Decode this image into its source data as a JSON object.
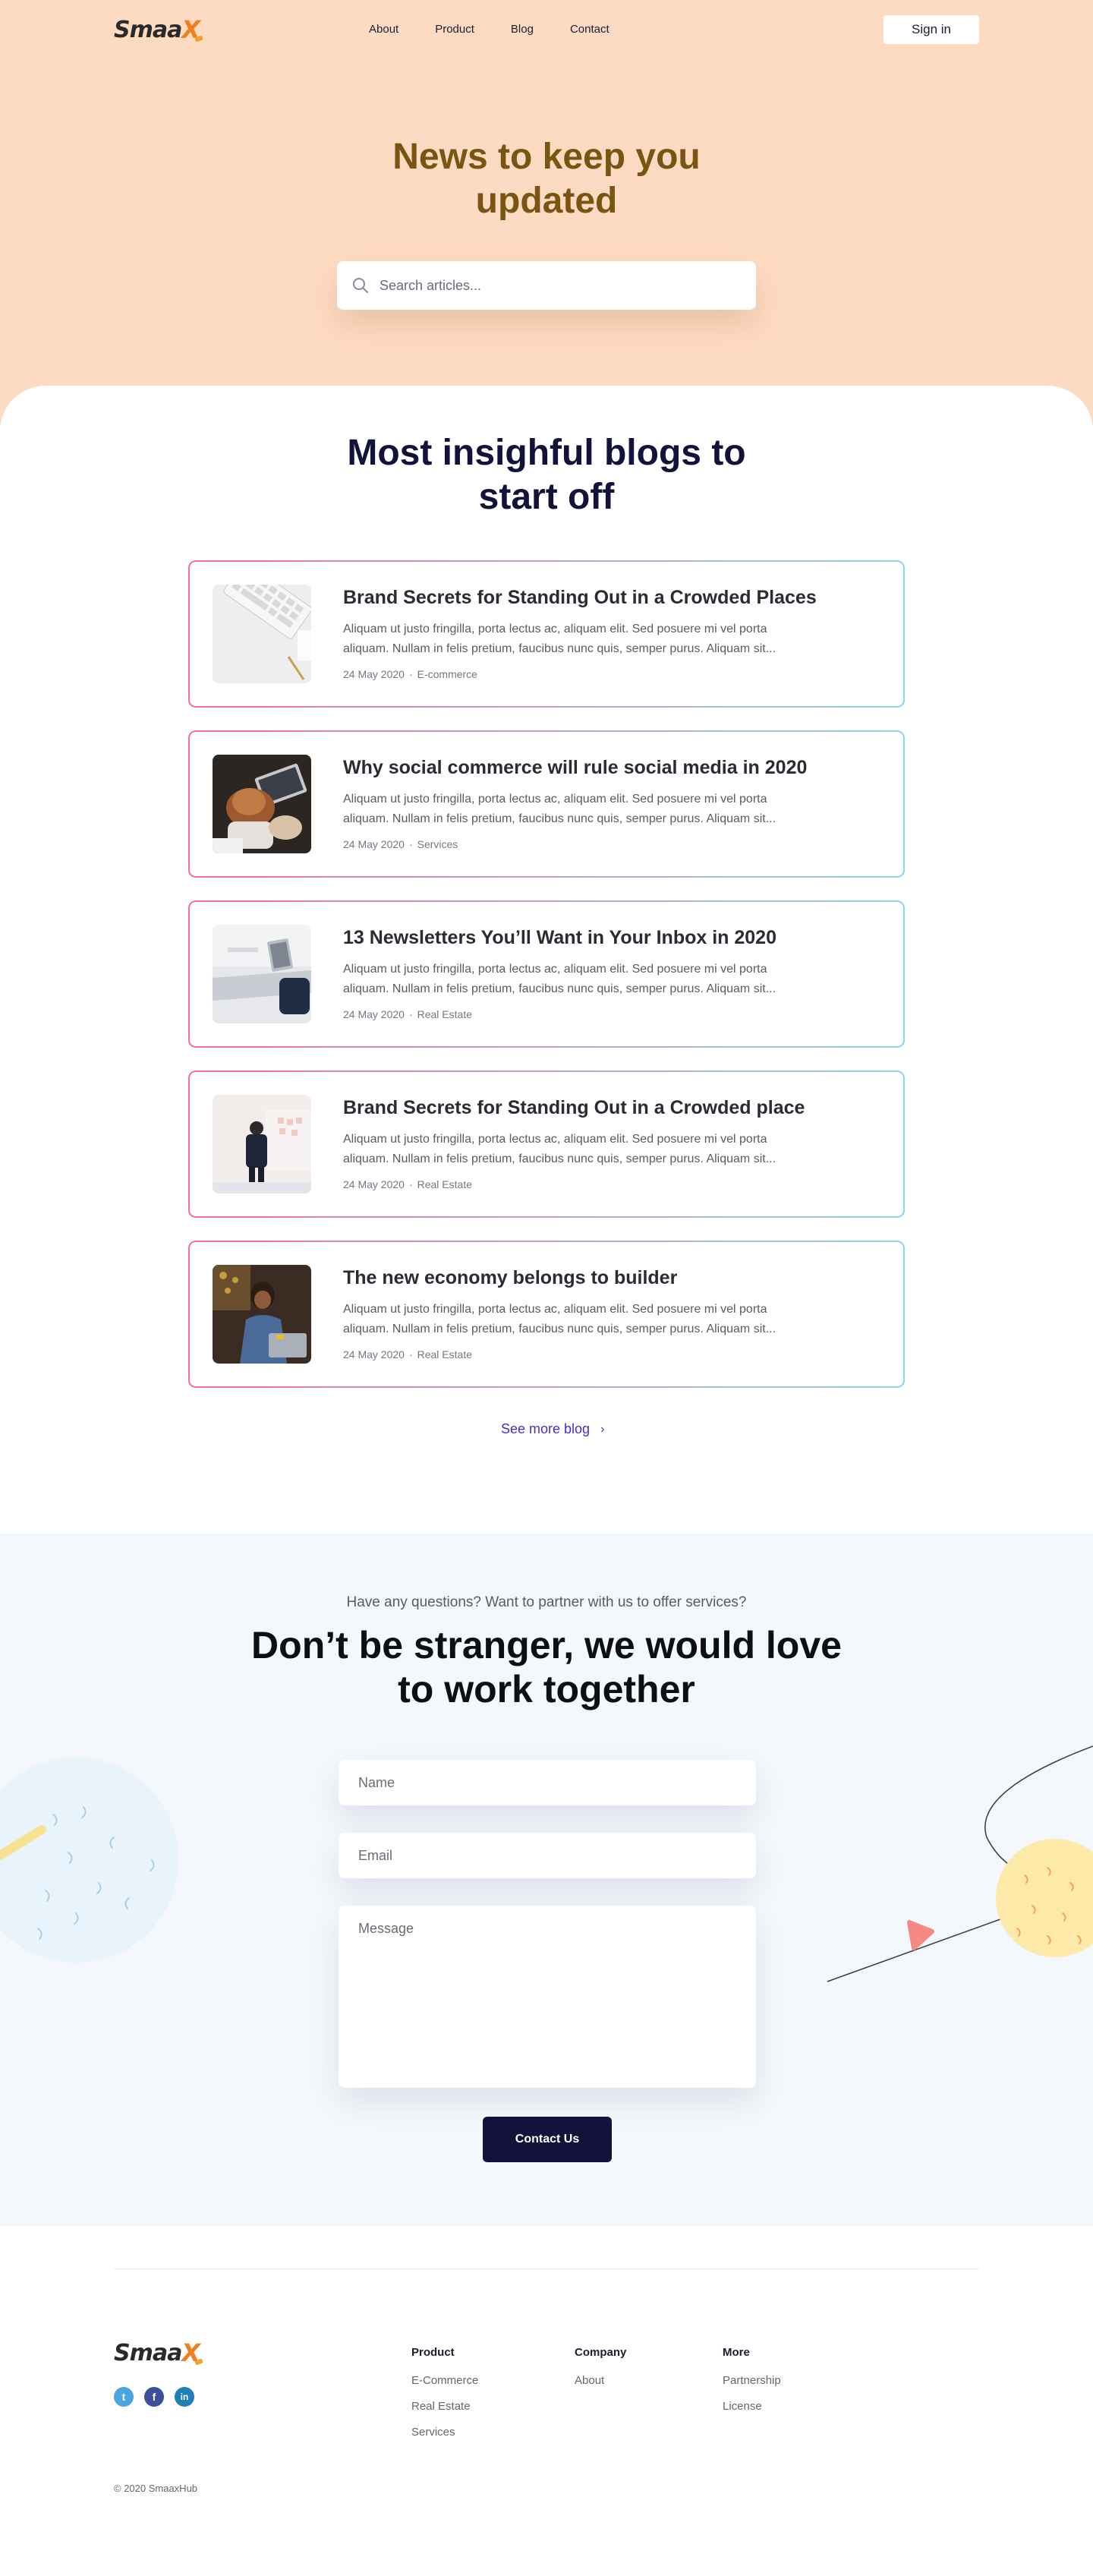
{
  "brand": {
    "logo_main": "Smaa",
    "logo_accent": "X",
    "brand_color": "#f07f1f"
  },
  "nav": {
    "links": [
      "About",
      "Product",
      "Blog",
      "Contact"
    ],
    "sign_in_label": "Sign in"
  },
  "hero": {
    "title": "News to keep you updated",
    "search_placeholder": "Search articles...",
    "background": "#fddbc2"
  },
  "blog": {
    "title": "Most insighful blogs to start off",
    "posts": [
      {
        "title": "Brand Secrets for Standing Out in a Crowded Places",
        "excerpt": "Aliquam ut justo fringilla, porta lectus ac, aliquam elit. Sed posuere mi vel porta aliquam. Nullam in felis pretium, faucibus nunc quis, semper purus.  Aliquam sit...",
        "date": "24 May 2020",
        "category": "E-commerce",
        "thumb": "keyboard-desk"
      },
      {
        "title": "Why social commerce will rule social media in 2020",
        "excerpt": "Aliquam ut justo fringilla, porta lectus ac, aliquam elit. Sed posuere mi vel porta aliquam. Nullam in felis pretium, faucibus nunc quis, semper purus.  Aliquam sit...",
        "date": "24 May 2020",
        "category": "Services",
        "thumb": "laptop-team"
      },
      {
        "title": "13 Newsletters You’ll Want in Your Inbox in 2020",
        "excerpt": "Aliquam ut justo fringilla, porta lectus ac, aliquam elit. Sed posuere mi vel porta aliquam. Nullam in felis pretium, faucibus nunc quis, semper purus.  Aliquam sit...",
        "date": "24 May 2020",
        "category": "Real Estate",
        "thumb": "office-desk"
      },
      {
        "title": "Brand Secrets for Standing Out in a Crowded place",
        "excerpt": "Aliquam ut justo fringilla, porta lectus ac, aliquam elit. Sed posuere mi vel porta aliquam. Nullam in felis pretium, faucibus nunc quis, semper purus.  Aliquam sit...",
        "date": "24 May 2020",
        "category": "Real Estate",
        "thumb": "whiteboard-person"
      },
      {
        "title": "The new economy belongs to builder",
        "excerpt": "Aliquam ut justo fringilla, porta lectus ac, aliquam elit. Sed posuere mi vel porta aliquam. Nullam in felis pretium, faucibus nunc quis, semper purus.  Aliquam sit...",
        "date": "24 May 2020",
        "category": "Real Estate",
        "thumb": "woman-laptop"
      }
    ],
    "see_more_label": "See more blog",
    "see_more_icon": "chevron-right-icon",
    "link_color": "#4a2bd0"
  },
  "contact": {
    "subtitle": "Have any questions? Want to partner with us to offer services?",
    "title": "Don’t be stranger, we would love to work together",
    "name_placeholder": "Name",
    "email_placeholder": "Email",
    "message_placeholder": "Message",
    "button_label": "Contact Us",
    "button_color": "#13123a"
  },
  "footer": {
    "socials": [
      {
        "name": "twitter-icon",
        "glyph": "t"
      },
      {
        "name": "facebook-icon",
        "glyph": "f"
      },
      {
        "name": "linkedin-icon",
        "glyph": "in"
      }
    ],
    "columns": [
      {
        "title": "Product",
        "links": [
          "E-Commerce",
          "Real Estate",
          "Services"
        ]
      },
      {
        "title": "Company",
        "links": [
          "About"
        ]
      },
      {
        "title": "More",
        "links": [
          "Partnership",
          "License"
        ]
      }
    ],
    "copyright": "© 2020 SmaaxHub"
  }
}
